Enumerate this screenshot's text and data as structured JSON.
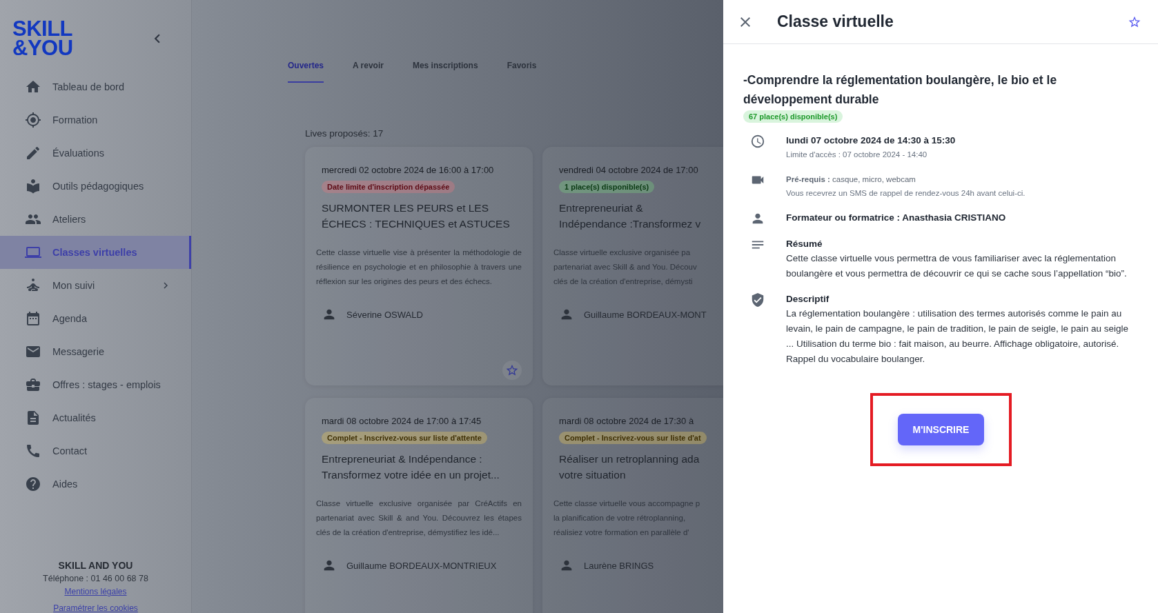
{
  "sidebar": {
    "logo_lines": [
      "SKILL",
      "&YOU"
    ],
    "items": [
      {
        "label": "Tableau de bord",
        "selected": false,
        "submenu": false
      },
      {
        "label": "Formation",
        "selected": false,
        "submenu": false
      },
      {
        "label": "Évaluations",
        "selected": false,
        "submenu": false
      },
      {
        "label": "Outils pédagogiques",
        "selected": false,
        "submenu": false
      },
      {
        "label": "Ateliers",
        "selected": false,
        "submenu": false
      },
      {
        "label": "Classes virtuelles",
        "selected": true,
        "submenu": false
      },
      {
        "label": "Mon suivi",
        "selected": false,
        "submenu": true
      },
      {
        "label": "Agenda",
        "selected": false,
        "submenu": false
      },
      {
        "label": "Messagerie",
        "selected": false,
        "submenu": false
      },
      {
        "label": "Offres : stages - emplois",
        "selected": false,
        "submenu": false
      },
      {
        "label": "Actualités",
        "selected": false,
        "submenu": false
      },
      {
        "label": "Contact",
        "selected": false,
        "submenu": false
      },
      {
        "label": "Aides",
        "selected": false,
        "submenu": false
      }
    ],
    "footer": {
      "company": "SKILL AND YOU",
      "phone": "Téléphone : 01 46 00 68 78",
      "links": [
        "Mentions légales",
        "Paramétrer les cookies"
      ]
    }
  },
  "tabs": [
    {
      "label": "Ouvertes",
      "selected": true
    },
    {
      "label": "A revoir",
      "selected": false
    },
    {
      "label": "Mes inscriptions",
      "selected": false
    },
    {
      "label": "Favoris",
      "selected": false
    }
  ],
  "count_label": "Lives proposés: 17",
  "cards": [
    {
      "date": "mercredi 02 octobre 2024 de 16:00 à 17:00",
      "status": {
        "label": "Date limite d'inscription dépassée",
        "kind": "error"
      },
      "title": "SURMONTER LES PEURS et LES ÉCHECS : TECHNIQUES et ASTUCES",
      "description": "Cette classe virtuelle vise à présenter la méthodologie de résilience en psychologie et en philosophie à travers une réflexion sur les origines des peurs et des échecs.",
      "trainer": "Séverine OSWALD",
      "favorite_button": true
    },
    {
      "date": "vendredi 04 octobre 2024 de 17:00",
      "status": {
        "label": "1 place(s) disponible(s)",
        "kind": "success"
      },
      "title": "Entrepreneuriat &\nIndépendance :Transformez v",
      "description": "Classe virtuelle exclusive organisée pa\npartenariat avec Skill & and You. Découv\nclés de la création d'entreprise, démysti",
      "trainer": "Guillaume BORDEAUX-MONT"
    },
    {
      "date": "mardi 08 octobre 2024 de 17:00 à 17:45",
      "status": {
        "label": "Complet - Inscrivez-vous sur liste d'attente",
        "kind": "warning"
      },
      "title": "Entrepreneuriat & Indépendance : Transformez votre idée en un projet...",
      "description": "Classe virtuelle exclusive organisée par CréActifs en partenariat avec Skill & and You. Découvrez les étapes clés de la création d'entreprise, démystifiez les idé...",
      "trainer": "Guillaume BORDEAUX-MONTRIEUX"
    },
    {
      "date": "mardi 08 octobre 2024 de 17:30 à",
      "status": {
        "label": "Complet - Inscrivez-vous sur liste d'at",
        "kind": "warning"
      },
      "title": "Réaliser un retroplanning ada\nvotre situation",
      "description": "Cette classe virtuelle vous accompagne p\nla planification de votre rétroplanning,\nréalisiez votre formation en parallèle d'",
      "trainer": "Laurène BRINGS"
    }
  ],
  "drawer": {
    "title": "Classe virtuelle",
    "favorite": false,
    "course_title": "-Comprendre la réglementation boulangère, le bio et le développement durable",
    "status": {
      "label": "67 place(s) disponible(s)",
      "kind": "success"
    },
    "rows": [
      {
        "title": "lundi 07 octobre 2024 de 14:30 à 15:30",
        "note": "Limite d'accès : 07 octobre 2024 - 14:40"
      },
      {
        "detail": "**Pré-requis :** casque, micro, webcam",
        "note": "Vous recevrez un SMS de rappel de rendez-vous 24h avant celui-ci."
      },
      {
        "title": "Formateur ou formatrice : Anasthasia CRISTIANO"
      },
      {
        "title": "Résumé",
        "body": "Cette classe virtuelle vous permettra de vous familiariser avec la réglementation boulangère et vous permettra de découvrir ce qui se cache sous l’appellation “bio”."
      },
      {
        "title": "Descriptif",
        "body": "La réglementation boulangère : utilisation des termes autorisés comme le pain au levain, le pain de campagne, le pain de tradition, le pain de seigle, le pain au seigle ... Utilisation du terme bio : fait maison, au beurre. Affichage obligatoire, autorisé. Rappel du vocabulaire boulanger."
      }
    ],
    "button": "M'INSCRIRE",
    "highlighted": true
  }
}
